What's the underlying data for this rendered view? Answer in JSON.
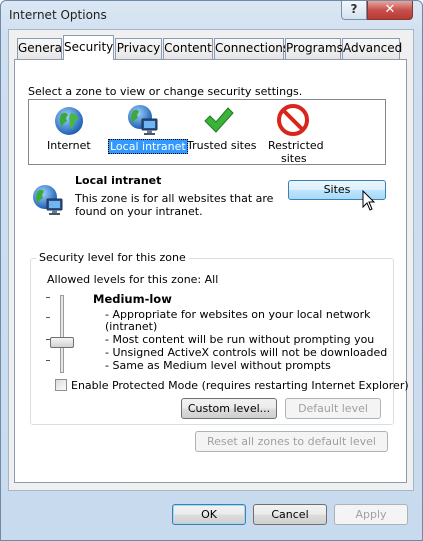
{
  "window": {
    "title": "Internet Options",
    "help_glyph": "?",
    "close_glyph": "✕"
  },
  "tabs": [
    "General",
    "Security",
    "Privacy",
    "Content",
    "Connections",
    "Programs",
    "Advanced"
  ],
  "active_tab": "Security",
  "security": {
    "instruction": "Select a zone to view or change security settings.",
    "zones": [
      {
        "label": "Internet",
        "icon": "globe-icon"
      },
      {
        "label": "Local intranet",
        "icon": "intranet-globe-icon",
        "selected": true
      },
      {
        "label": "Trusted sites",
        "icon": "checkmark-icon"
      },
      {
        "label_line1": "Restricted",
        "label_line2": "sites",
        "icon": "no-entry-icon"
      }
    ],
    "zone_info": {
      "name": "Local intranet",
      "desc_line1": "This zone is for all websites that are",
      "desc_line2": "found on your intranet.",
      "sites_button": "Sites"
    },
    "level_group": {
      "title": "Security level for this zone",
      "allowed": "Allowed levels for this zone: All",
      "level_name": "Medium-low",
      "bullets": [
        "- Appropriate for websites on your local network",
        "(intranet)",
        "- Most content will be run without prompting you",
        "- Unsigned ActiveX controls will not be downloaded",
        "- Same as Medium level without prompts"
      ],
      "protected_mode": "Enable Protected Mode (requires restarting Internet Explorer)",
      "protected_mode_checked": false,
      "custom_button": "Custom level...",
      "default_button": "Default level"
    },
    "reset_button": "Reset all zones to default level"
  },
  "footer": {
    "ok": "OK",
    "cancel": "Cancel",
    "apply": "Apply"
  },
  "colors": {
    "selection": "#3399ff",
    "close_red": "#c75050",
    "check_green": "#3bb33b",
    "no_entry_red": "#d9261c"
  }
}
